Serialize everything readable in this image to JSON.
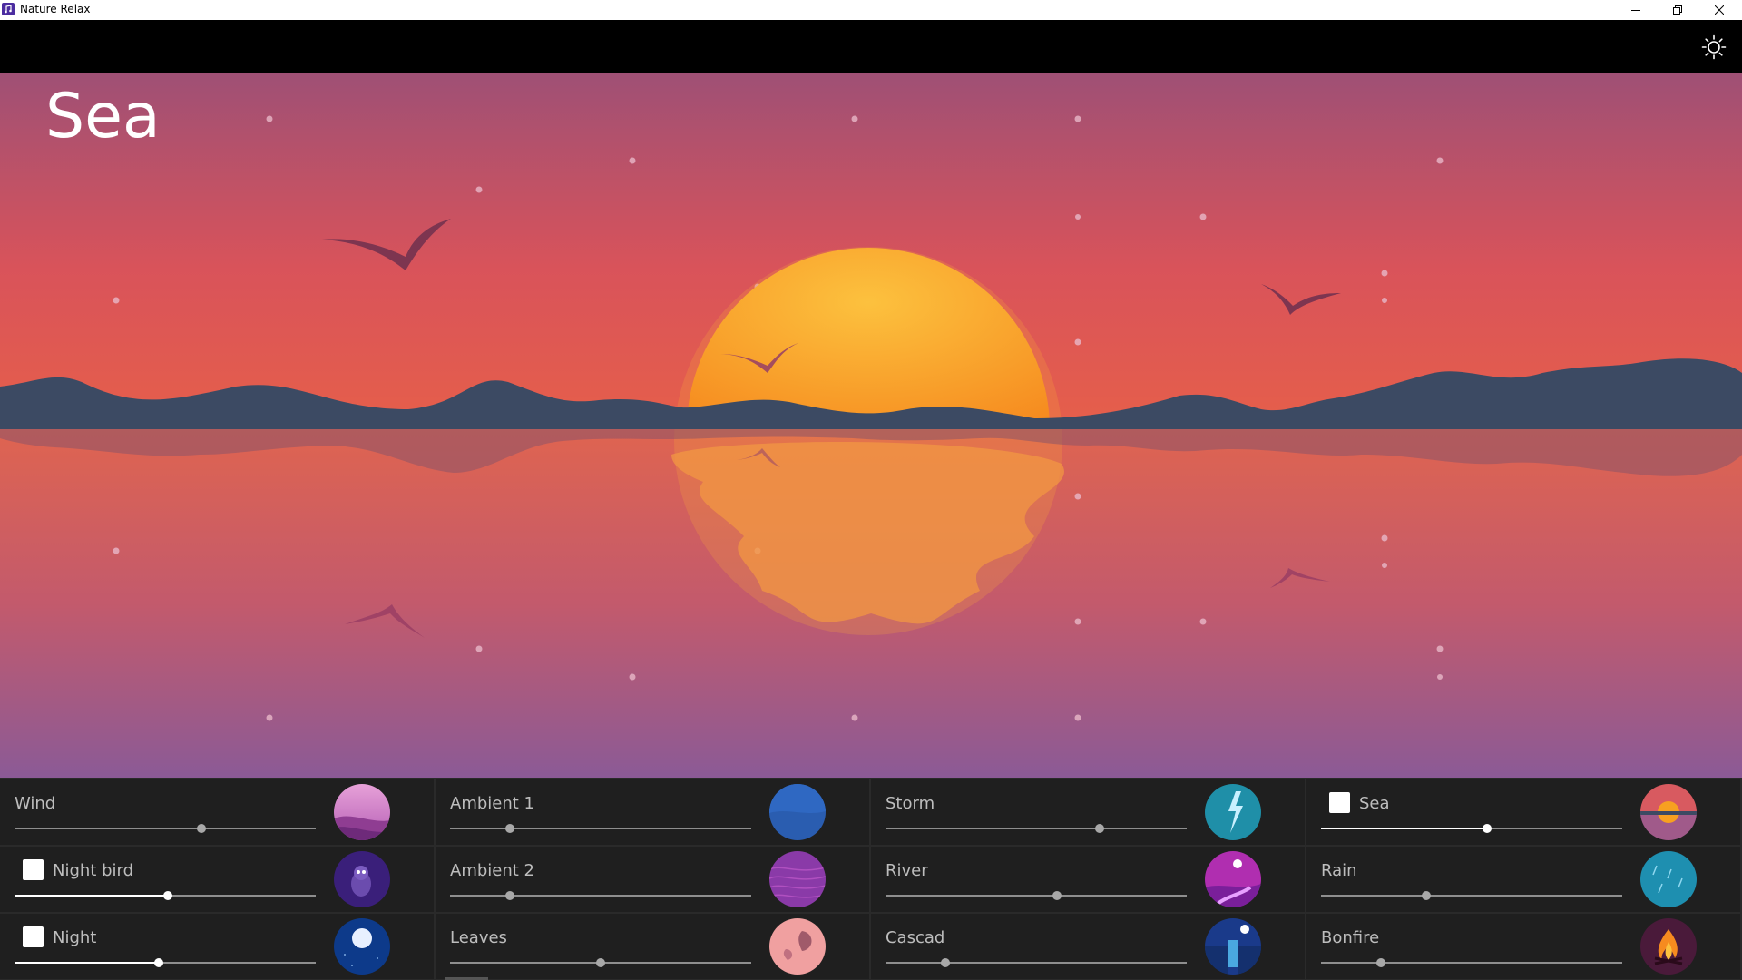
{
  "window": {
    "title": "Nature Relax",
    "controls": [
      "minimize",
      "restore",
      "close"
    ]
  },
  "toolbar": {
    "settings_icon": "sun-icon"
  },
  "scene": {
    "title": "Sea",
    "colors": {
      "sky_top": "#a0507a",
      "sky_mid": "#e0584f",
      "sun": "#f7a020",
      "hills": "#3c4a63",
      "water_bottom": "#8c5a96"
    }
  },
  "sounds": [
    {
      "label": "Wind",
      "checked": false,
      "has_checkbox": false,
      "volume": 0.62,
      "thumb": "wind"
    },
    {
      "label": "Ambient 1",
      "checked": false,
      "has_checkbox": false,
      "volume": 0.2,
      "thumb": "ambient1"
    },
    {
      "label": "Storm",
      "checked": false,
      "has_checkbox": false,
      "volume": 0.71,
      "thumb": "storm"
    },
    {
      "label": "Sea",
      "checked": true,
      "has_checkbox": true,
      "volume": 0.55,
      "thumb": "sea"
    },
    {
      "label": "Night bird",
      "checked": true,
      "has_checkbox": true,
      "volume": 0.51,
      "thumb": "nightbird"
    },
    {
      "label": "Ambient 2",
      "checked": false,
      "has_checkbox": false,
      "volume": 0.2,
      "thumb": "ambient2"
    },
    {
      "label": "River",
      "checked": false,
      "has_checkbox": false,
      "volume": 0.57,
      "thumb": "river"
    },
    {
      "label": "Rain",
      "checked": false,
      "has_checkbox": false,
      "volume": 0.35,
      "thumb": "rain"
    },
    {
      "label": "Night",
      "checked": true,
      "has_checkbox": true,
      "volume": 0.48,
      "thumb": "night"
    },
    {
      "label": "Leaves",
      "checked": false,
      "has_checkbox": false,
      "volume": 0.5,
      "thumb": "leaves"
    },
    {
      "label": "Cascad",
      "checked": false,
      "has_checkbox": false,
      "volume": 0.2,
      "thumb": "cascade"
    },
    {
      "label": "Bonfire",
      "checked": false,
      "has_checkbox": false,
      "volume": 0.2,
      "thumb": "bonfire"
    }
  ]
}
